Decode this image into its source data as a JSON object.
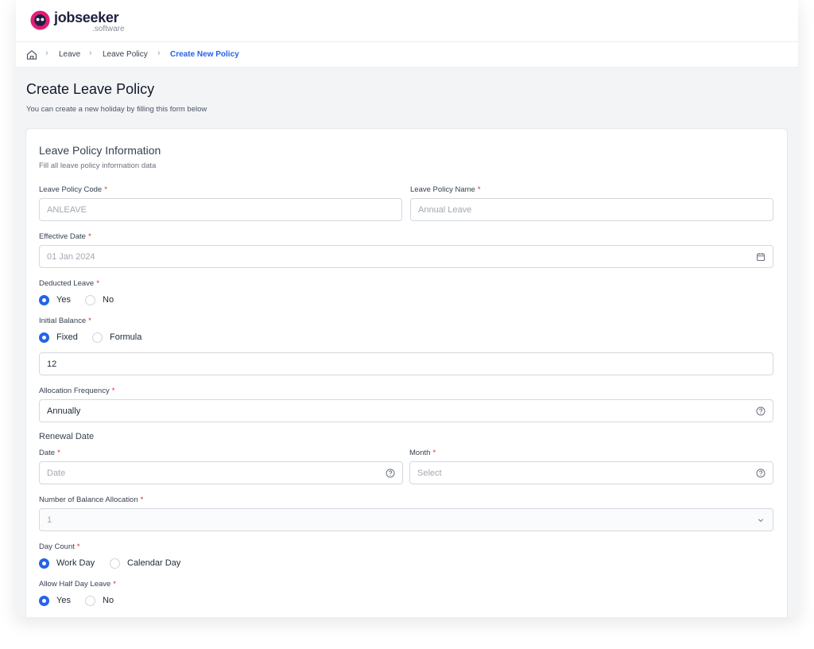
{
  "brand": {
    "name": "jobseeker",
    "suffix": ".software",
    "primary_color": "#e11d74",
    "accent_color": "#2563eb"
  },
  "breadcrumb": {
    "home_icon": "home-icon",
    "items": [
      "Leave",
      "Leave Policy",
      "Create New Policy"
    ]
  },
  "page": {
    "title": "Create Leave Policy",
    "subtitle": "You can create a new holiday by filling this form below"
  },
  "section": {
    "title": "Leave Policy Information",
    "subtitle": "Fill all leave policy information data"
  },
  "fields": {
    "code": {
      "label": "Leave Policy Code",
      "placeholder": "ANLEAVE"
    },
    "name": {
      "label": "Leave Policy Name",
      "placeholder": "Annual Leave"
    },
    "effective_date": {
      "label": "Effective Date",
      "placeholder": "01 Jan 2024",
      "icon": "calendar-icon"
    },
    "deducted_leave": {
      "label": "Deducted Leave",
      "options": [
        "Yes",
        "No"
      ],
      "selected": "Yes"
    },
    "initial_balance": {
      "label": "Initial Balance",
      "options": [
        "Fixed",
        "Formula"
      ],
      "selected": "Fixed",
      "value": "12"
    },
    "allocation_frequency": {
      "label": "Allocation Frequency",
      "value": "Annually",
      "icon": "help-circle-icon"
    },
    "renewal": {
      "heading": "Renewal Date",
      "date": {
        "label": "Date",
        "placeholder": "Date",
        "icon": "help-circle-icon"
      },
      "month": {
        "label": "Month",
        "placeholder": "Select",
        "icon": "help-circle-icon"
      }
    },
    "balance_allocation": {
      "label": "Number of Balance Allocation",
      "value": "1",
      "icon": "chevron-down-icon"
    },
    "day_count": {
      "label": "Day Count",
      "options": [
        "Work Day",
        "Calendar Day"
      ],
      "selected": "Work Day"
    },
    "half_day": {
      "label": "Allow Half Day Leave",
      "options": [
        "Yes",
        "No"
      ],
      "selected": "Yes"
    }
  },
  "required_marker": "*"
}
